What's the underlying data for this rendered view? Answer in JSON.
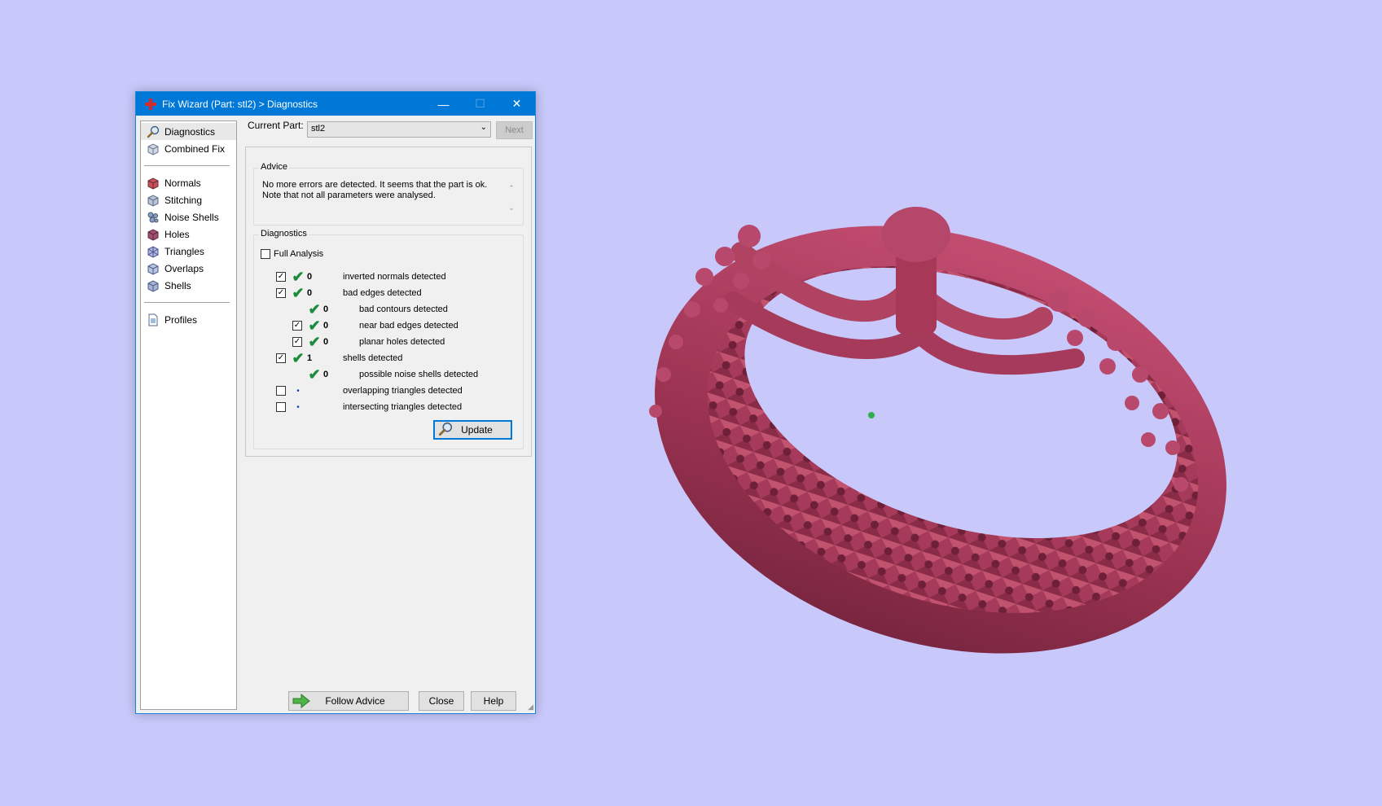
{
  "window": {
    "title": "Fix Wizard (Part: stl2) > Diagnostics",
    "controls": {
      "minimize": "—",
      "maximize": "☐",
      "close": "✕"
    }
  },
  "nav": {
    "top": [
      {
        "label": "Diagnostics",
        "icon": "magnifier-icon"
      },
      {
        "label": "Combined Fix",
        "icon": "cube-icon"
      }
    ],
    "tools": [
      {
        "label": "Normals",
        "icon": "normals-cube-icon"
      },
      {
        "label": "Stitching",
        "icon": "stitching-cube-icon"
      },
      {
        "label": "Noise Shells",
        "icon": "noise-shells-icon"
      },
      {
        "label": "Holes",
        "icon": "holes-cube-icon"
      },
      {
        "label": "Triangles",
        "icon": "triangles-cube-icon"
      },
      {
        "label": "Overlaps",
        "icon": "overlaps-cube-icon"
      },
      {
        "label": "Shells",
        "icon": "shells-cube-icon"
      }
    ],
    "bottom": [
      {
        "label": "Profiles",
        "icon": "document-icon"
      }
    ]
  },
  "current_part": {
    "label": "Current Part:",
    "value": "stl2",
    "next_label": "Next"
  },
  "advice": {
    "group_label": "Advice",
    "line1": "No more errors are detected. It seems that the part is ok.",
    "line2": "Note that not all parameters were analysed."
  },
  "diagnostics": {
    "group_label": "Diagnostics",
    "full_analysis_label": "Full Analysis",
    "rows": [
      {
        "checked": true,
        "status": "ok",
        "count": "0",
        "label": "inverted normals detected",
        "indent": 0
      },
      {
        "checked": true,
        "status": "ok",
        "count": "0",
        "label": "bad edges detected",
        "indent": 0
      },
      {
        "checked": null,
        "status": "ok",
        "count": "0",
        "label": "bad contours detected",
        "indent": 1
      },
      {
        "checked": true,
        "status": "ok",
        "count": "0",
        "label": "near bad edges detected",
        "indent": 1
      },
      {
        "checked": true,
        "status": "ok",
        "count": "0",
        "label": "planar holes detected",
        "indent": 1
      },
      {
        "checked": true,
        "status": "ok",
        "count": "1",
        "label": "shells detected",
        "indent": 0
      },
      {
        "checked": null,
        "status": "ok",
        "count": "0",
        "label": "possible noise shells detected",
        "indent": 1
      },
      {
        "checked": false,
        "status": "pending",
        "count": "",
        "label": "overlapping triangles detected",
        "indent": 0
      },
      {
        "checked": false,
        "status": "pending",
        "count": "",
        "label": "intersecting triangles detected",
        "indent": 0
      }
    ],
    "update_label": "Update"
  },
  "footer": {
    "follow_advice_label": "Follow Advice",
    "close_label": "Close",
    "help_label": "Help"
  },
  "colors": {
    "background": "#c8c8fa",
    "titlebar": "#0078d7",
    "ring": "#a83858",
    "check": "#1e8a3c"
  }
}
